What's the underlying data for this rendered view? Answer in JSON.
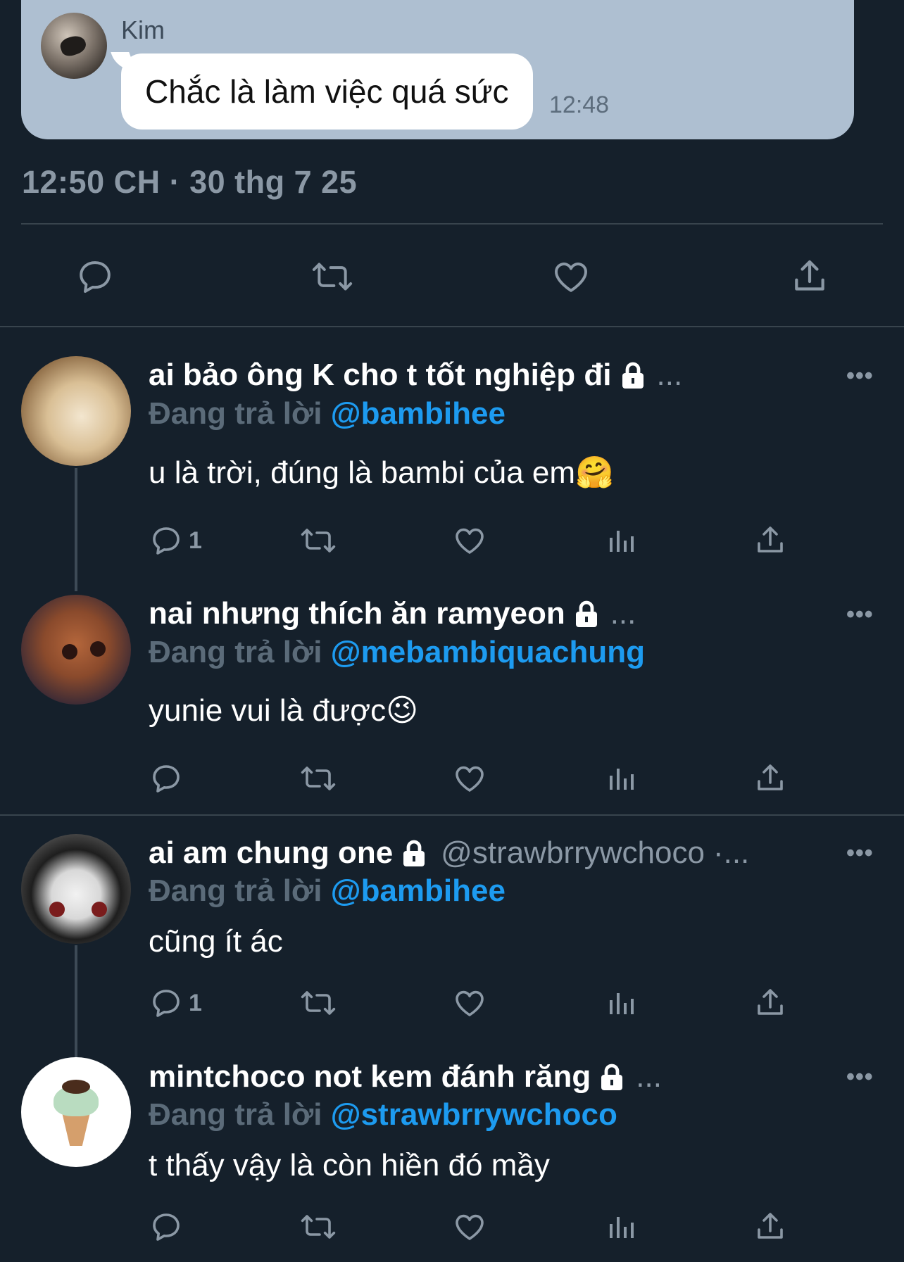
{
  "chat": {
    "sender": "Kim",
    "message": "Chắc là làm việc quá sức",
    "time": "12:48"
  },
  "tweet": {
    "timestamp": "12:50 CH · 30 thg 7 25",
    "actions": [
      "reply-icon",
      "retweet-icon",
      "like-icon",
      "share-icon"
    ]
  },
  "replies": [
    {
      "name": "ai bảo ông K cho t tốt nghiệp đi",
      "handle": "",
      "dots": "...",
      "replying_prefix": "Đang trả lời",
      "replying_to": "@bambihee",
      "text": "u là trời, đúng là bambi của em🤗",
      "reply_count": "1"
    },
    {
      "name": "nai nhưng thích ăn ramyeon",
      "handle": "",
      "dots": "...",
      "replying_prefix": "Đang trả lời",
      "replying_to": "@mebambiquachung",
      "text": "yunie vui là được😉",
      "reply_count": ""
    },
    {
      "name": "ai am chung one",
      "handle": "@strawbrrywchoco",
      "dots": "·...",
      "replying_prefix": "Đang trả lời",
      "replying_to": "@bambihee",
      "text": "cũng ít ác",
      "reply_count": "1"
    },
    {
      "name": "mintchoco not kem đánh răng",
      "handle": "",
      "dots": "...",
      "replying_prefix": "Đang trả lời",
      "replying_to": "@strawbrrywchoco",
      "text": "t thấy vậy là còn hiền đó mầy",
      "reply_count": ""
    }
  ],
  "more_label": "•••",
  "colors": {
    "background": "#15202b",
    "accent": "#1d9bf0",
    "muted": "#8b98a5",
    "chat_bg": "#aebfd1"
  }
}
